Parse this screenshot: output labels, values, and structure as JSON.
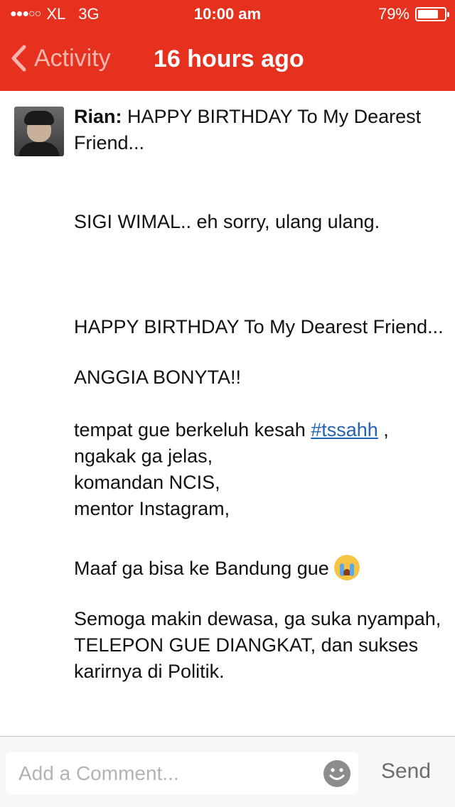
{
  "status_bar": {
    "signal": "●●●○○",
    "carrier": "XL",
    "network": "3G",
    "time": "10:00 am",
    "battery": "79%",
    "battery_level": 0.79
  },
  "nav": {
    "back_label": "Activity",
    "title": "16 hours ago"
  },
  "post": {
    "author": "Rian:",
    "first_line": " HAPPY BIRTHDAY To My Dearest Friend...",
    "line2": "SIGI WIMAL.. eh sorry, ulang ulang.",
    "line3": "HAPPY BIRTHDAY To My Dearest Friend...",
    "line4": "ANGGIA BONYTA!!",
    "line5_before": "tempat gue berkeluh kesah ",
    "hashtag": "#tssahh",
    "line5_after": " ,",
    "line6": "ngakak ga jelas,",
    "line7": "komandan NCIS,",
    "line8": "mentor Instagram,",
    "line9": "Maaf ga bisa ke Bandung gue ",
    "line10": "Semoga makin dewasa, ga suka nyampah, TELEPON GUE DIANGKAT, dan sukses karirnya di Politik."
  },
  "composer": {
    "placeholder": "Add a Comment...",
    "send_label": "Send"
  },
  "colors": {
    "accent": "#e5311e",
    "link": "#2163b7"
  },
  "icons": [
    "back-chevron-icon",
    "battery-icon",
    "avatar",
    "crying-face-emoji",
    "smiley-face-icon"
  ]
}
